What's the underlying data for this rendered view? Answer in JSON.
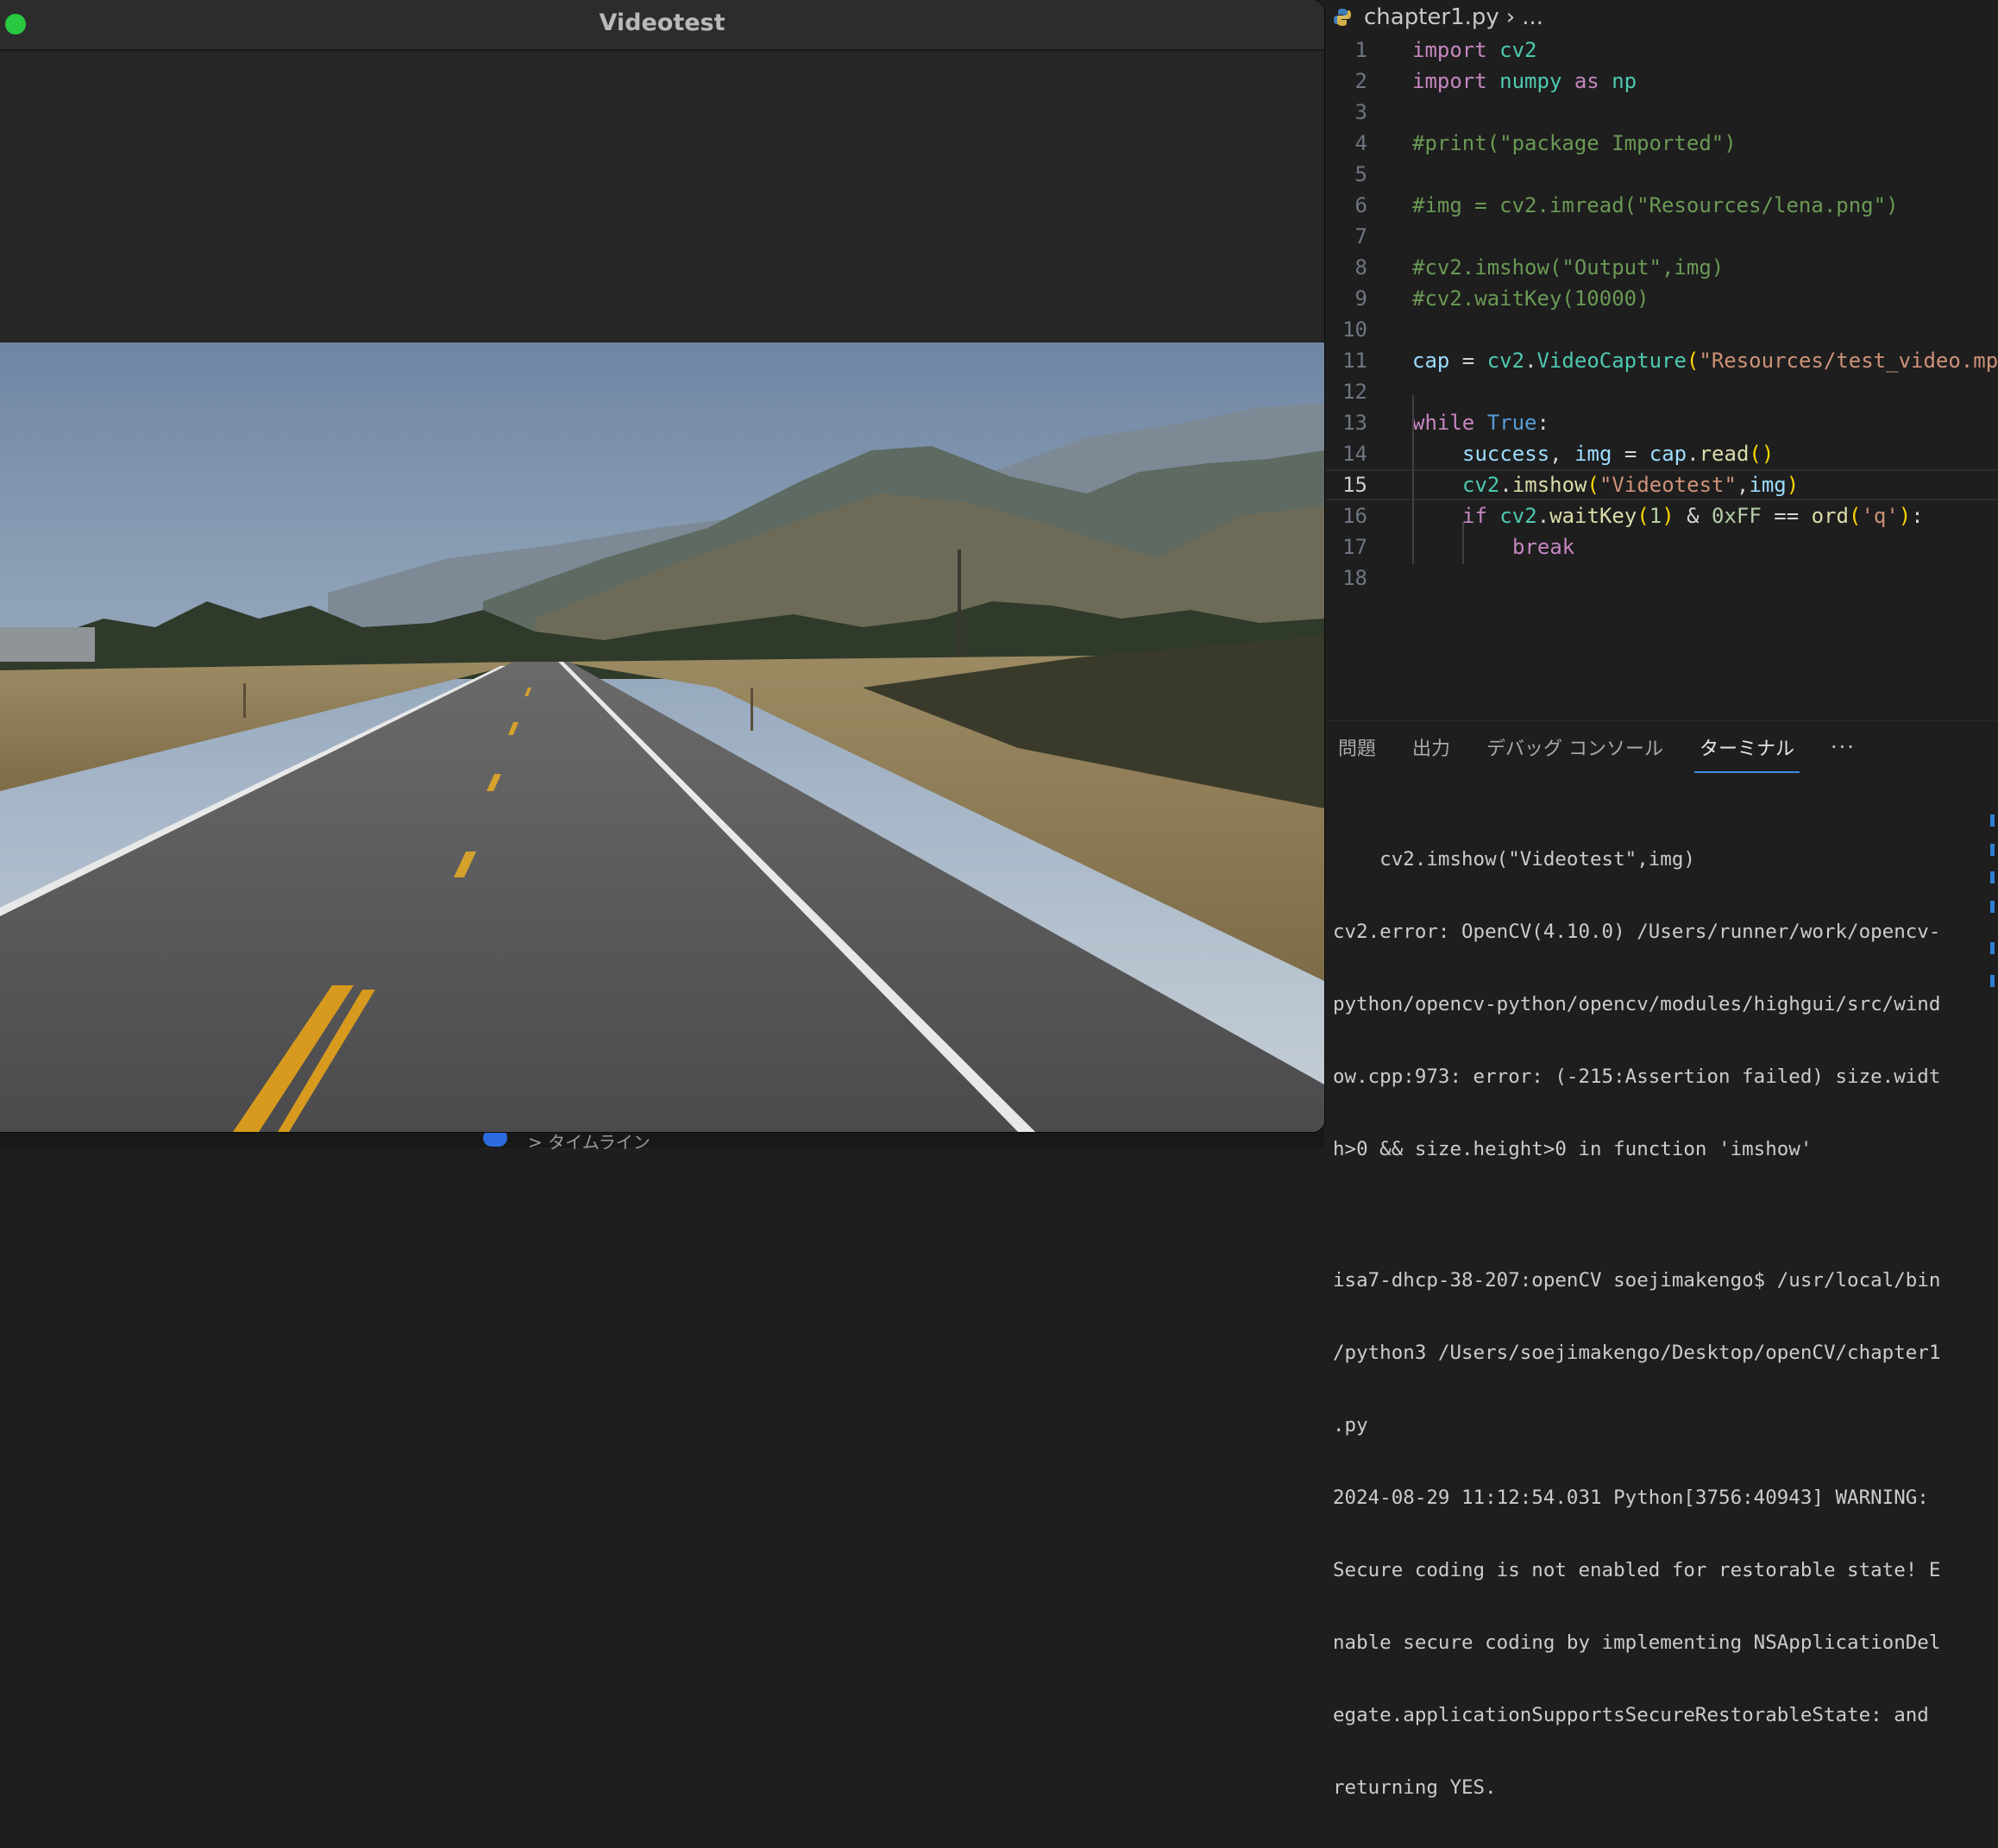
{
  "video_window": {
    "title": "Videotest"
  },
  "editor": {
    "breadcrumb": {
      "file": "chapter1.py",
      "more": "..."
    },
    "active_line": 15,
    "lines": [
      {
        "n": "1"
      },
      {
        "n": "2"
      },
      {
        "n": "3"
      },
      {
        "n": "4"
      },
      {
        "n": "5"
      },
      {
        "n": "6"
      },
      {
        "n": "7"
      },
      {
        "n": "8"
      },
      {
        "n": "9"
      },
      {
        "n": "10"
      },
      {
        "n": "11"
      },
      {
        "n": "12"
      },
      {
        "n": "13"
      },
      {
        "n": "14"
      },
      {
        "n": "15"
      },
      {
        "n": "16"
      },
      {
        "n": "17"
      },
      {
        "n": "18"
      }
    ],
    "code": {
      "l1_kw": "import",
      "l1_mod": " cv2",
      "l2_kw": "import",
      "l2_mod": " numpy",
      "l2_as": " as",
      "l2_np": " np",
      "l4": "#print(\"package Imported\")",
      "l6": "#img = cv2.imread(\"Resources/lena.png\")",
      "l8": "#cv2.imshow(\"Output\",img)",
      "l9": "#cv2.waitKey(10000)",
      "l11_var": "cap",
      "l11_eq": " = ",
      "l11_mod": "cv2",
      "l11_dot": ".",
      "l11_fn": "VideoCapture",
      "l11_p": "(",
      "l11_str": "\"Resources/test_video.mp",
      "l13_kw": "while",
      "l13_bl": " True",
      "l13_c": ":",
      "l14_a": "success",
      "l14_b": ", ",
      "l14_c": "img",
      "l14_d": " = ",
      "l14_e": "cap",
      "l14_f": ".",
      "l14_g": "read",
      "l14_h": "()",
      "l15_a": "cv2",
      "l15_b": ".",
      "l15_c": "imshow",
      "l15_d": "(",
      "l15_e": "\"Videotest\"",
      "l15_f": ",",
      "l15_g": "img",
      "l15_h": ")",
      "l16_kw": "if",
      "l16_a": " cv2",
      "l16_b": ".",
      "l16_c": "waitKey",
      "l16_d": "(",
      "l16_e": "1",
      "l16_f": ")",
      "l16_g": " & ",
      "l16_h": "0xFF",
      "l16_i": " == ",
      "l16_j": "ord",
      "l16_k": "(",
      "l16_l": "'q'",
      "l16_m": ")",
      "l16_n": ":",
      "l17_kw": "break"
    }
  },
  "panel": {
    "tabs": [
      "問題",
      "出力",
      "デバッグ コンソール",
      "ターミナル"
    ],
    "active_tab": "ターミナル",
    "more": "···",
    "terminal": [
      "    cv2.imshow(\"Videotest\",img)",
      "cv2.error: OpenCV(4.10.0) /Users/runner/work/opencv-",
      "python/opencv-python/opencv/modules/highgui/src/wind",
      "ow.cpp:973: error: (-215:Assertion failed) size.widt",
      "h>0 && size.height>0 in function 'imshow'",
      "",
      "isa7-dhcp-38-207:openCV soejimakengo$ /usr/local/bin",
      "/python3 /Users/soejimakengo/Desktop/openCV/chapter1",
      ".py",
      "2024-08-29 11:12:54.031 Python[3756:40943] WARNING:",
      "Secure coding is not enabled for restorable state! E",
      "nable secure coding by implementing NSApplicationDel",
      "egate.applicationSupportsSecureRestorableState: and",
      "returning YES."
    ]
  },
  "footer": {
    "timeline_label": "> タイムライン"
  }
}
